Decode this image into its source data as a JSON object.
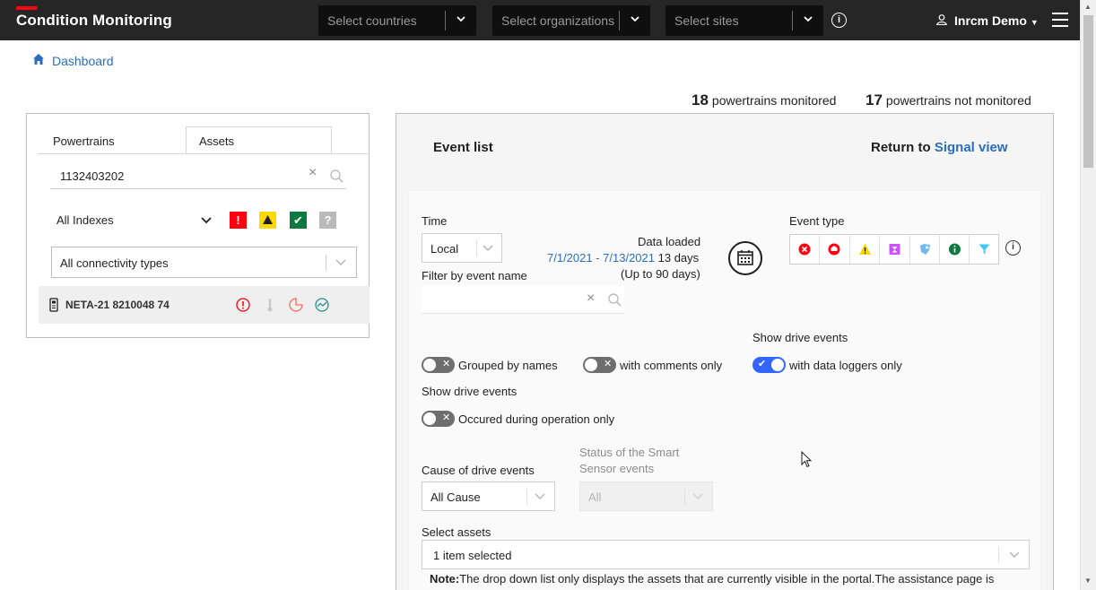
{
  "app": {
    "title": "Condition Monitoring",
    "brand_color": "#ff000f"
  },
  "header": {
    "countries_placeholder": "Select countries",
    "organizations_placeholder": "Select organizations",
    "sites_placeholder": "Select sites",
    "user_name": "Inrcm Demo"
  },
  "breadcrumb": {
    "label": "Dashboard"
  },
  "monitoring": {
    "monitored_count": "18",
    "monitored_label": "powertrains monitored",
    "not_monitored_count": "17",
    "not_monitored_label": "powertrains not monitored"
  },
  "left_panel": {
    "tabs": [
      "Powertrains",
      "Assets"
    ],
    "active_tab": "Assets",
    "search_value": "1132403202",
    "index_filter": "All Indexes",
    "status_badges": [
      {
        "icon": "alarm-icon",
        "color": "#ff000f",
        "glyph": "!"
      },
      {
        "icon": "warning-icon",
        "color": "#ffd800",
        "glyph": "!"
      },
      {
        "icon": "ok-icon",
        "color": "#0c7a3f",
        "glyph": "✔"
      },
      {
        "icon": "unknown-icon",
        "color": "#bababa",
        "glyph": "?"
      }
    ],
    "connectivity_filter": "All connectivity types",
    "assets": [
      {
        "name": "NETA-21 8210048 74"
      }
    ]
  },
  "event_panel": {
    "title": "Event list",
    "return_prefix": "Return to",
    "return_link": "Signal view",
    "time_label": "Time",
    "time_value": "Local",
    "data_loaded_label": "Data loaded",
    "date_range": "7/1/2021 - 7/13/2021",
    "days": "13 days",
    "max_days": "(Up to 90 days)",
    "event_type_label": "Event type",
    "event_types": [
      {
        "icon": "fault-icon",
        "color": "#ff000f"
      },
      {
        "icon": "alarm-icon",
        "color": "#ff000f"
      },
      {
        "icon": "warning-icon",
        "color": "#ffd800"
      },
      {
        "icon": "custom-event-icon",
        "color": "#cc50ff"
      },
      {
        "icon": "notification-icon",
        "color": "#6fb7f5"
      },
      {
        "icon": "info-event-icon",
        "color": "#0c7a3f"
      },
      {
        "icon": "filter-event-icon",
        "color": "#3ec6ff"
      }
    ],
    "filter_name_label": "Filter by event name",
    "filter_name_value": "",
    "toggles": {
      "grouped_by_names": {
        "label": "Grouped by names",
        "on": false
      },
      "with_comments_only": {
        "label": "with comments only",
        "on": false
      },
      "with_data_loggers_only": {
        "label": "with data loggers only",
        "on": true
      },
      "occured_during_operation": {
        "label": "Occured during operation only",
        "on": false
      }
    },
    "show_drive_events_label_1": "Show drive events",
    "show_drive_events_label_2": "Show drive events",
    "cause_label": "Cause of drive events",
    "cause_value": "All Cause",
    "smart_sensor_label_line1": "Status of the Smart",
    "smart_sensor_label_line2": "Sensor events",
    "smart_sensor_value": "All",
    "select_assets_label": "Select assets",
    "select_assets_value": "1 item selected",
    "note_prefix": "Note:",
    "note_text": "The drop down list only displays the assets that are currently visible in the portal.The assistance page is"
  }
}
